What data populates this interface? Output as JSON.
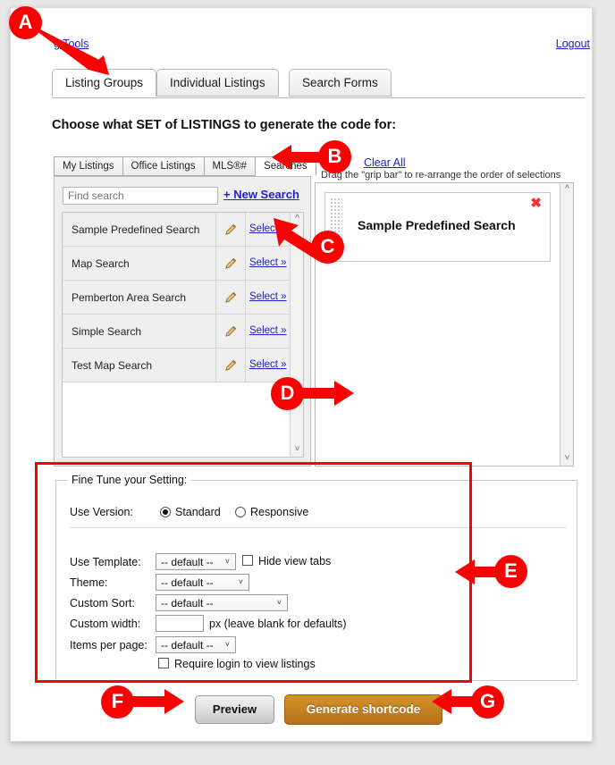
{
  "header": {
    "tools_link": "g Tools",
    "logout_link": "Logout"
  },
  "main_tabs": [
    {
      "label": "Listing Groups",
      "active": true
    },
    {
      "label": "Individual Listings",
      "active": false
    },
    {
      "label": "Search Forms",
      "active": false
    }
  ],
  "heading": "Choose what SET of LISTINGS to generate the code for:",
  "sub_tabs": [
    {
      "label": "My Listings",
      "active": false
    },
    {
      "label": "Office Listings",
      "active": false
    },
    {
      "label": "MLS®#",
      "active": false
    },
    {
      "label": "Searches",
      "active": true
    }
  ],
  "picker": {
    "find_placeholder": "Find search",
    "find_value": "",
    "new_search_label": "+ New Search",
    "select_label": "Select »",
    "rows": [
      {
        "name": "Sample Predefined Search"
      },
      {
        "name": "Map Search"
      },
      {
        "name": "Pemberton Area Search"
      },
      {
        "name": "Simple Search"
      },
      {
        "name": "Test Map Search"
      }
    ]
  },
  "selection_panel": {
    "clear_all_label": "Clear All",
    "grip_hint": "Drag the \"grip bar\" to re-arrange the order of selections",
    "items": [
      {
        "title": "Sample Predefined Search",
        "close_glyph": "✖"
      }
    ]
  },
  "fine_tune": {
    "legend": "Fine Tune your Setting:",
    "use_version": {
      "label": "Use Version:",
      "options": [
        {
          "label": "Standard",
          "checked": true
        },
        {
          "label": "Responsive",
          "checked": false
        }
      ]
    },
    "use_template": {
      "label": "Use Template:",
      "value": "-- default --",
      "options": [
        "-- default --"
      ]
    },
    "hide_view_tabs": {
      "label": "Hide view tabs",
      "checked": false
    },
    "theme": {
      "label": "Theme:",
      "value": "-- default --",
      "options": [
        "-- default --"
      ]
    },
    "custom_sort": {
      "label": "Custom Sort:",
      "value": "-- default --",
      "options": [
        "-- default --"
      ]
    },
    "custom_width": {
      "label": "Custom width:",
      "value": "",
      "suffix": "px (leave blank for defaults)"
    },
    "items_per_page": {
      "label": "Items per page:",
      "value": "-- default --",
      "options": [
        "-- default --"
      ]
    },
    "require_login": {
      "label": "Require login to view listings",
      "checked": false
    }
  },
  "actions": {
    "preview_label": "Preview",
    "generate_label": "Generate shortcode"
  },
  "annotations": [
    {
      "id": "A",
      "target": "listing-groups-tab"
    },
    {
      "id": "B",
      "target": "searches-subtab"
    },
    {
      "id": "C",
      "target": "select-link-row-0"
    },
    {
      "id": "D",
      "target": "selection-panel"
    },
    {
      "id": "E",
      "target": "fine-tune-section"
    },
    {
      "id": "F",
      "target": "preview-button"
    },
    {
      "id": "G",
      "target": "generate-shortcode-button"
    }
  ],
  "colors": {
    "annotation_red": "#fb0000",
    "link_blue": "#2222cc",
    "generate_orange": "#c5821f"
  }
}
